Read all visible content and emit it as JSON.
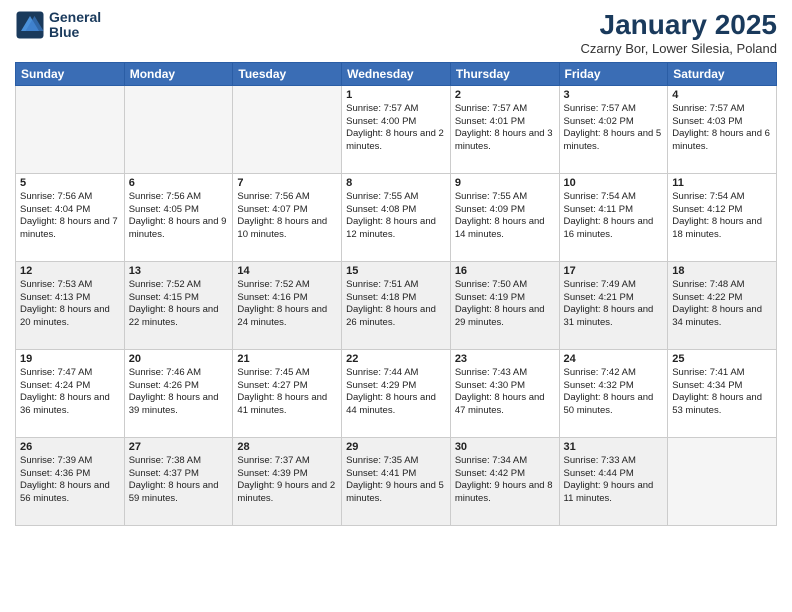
{
  "logo": {
    "line1": "General",
    "line2": "Blue"
  },
  "title": "January 2025",
  "subtitle": "Czarny Bor, Lower Silesia, Poland",
  "headers": [
    "Sunday",
    "Monday",
    "Tuesday",
    "Wednesday",
    "Thursday",
    "Friday",
    "Saturday"
  ],
  "weeks": [
    [
      {
        "day": "",
        "text": "",
        "empty": true
      },
      {
        "day": "",
        "text": "",
        "empty": true
      },
      {
        "day": "",
        "text": "",
        "empty": true
      },
      {
        "day": "1",
        "text": "Sunrise: 7:57 AM\nSunset: 4:00 PM\nDaylight: 8 hours and 2 minutes."
      },
      {
        "day": "2",
        "text": "Sunrise: 7:57 AM\nSunset: 4:01 PM\nDaylight: 8 hours and 3 minutes."
      },
      {
        "day": "3",
        "text": "Sunrise: 7:57 AM\nSunset: 4:02 PM\nDaylight: 8 hours and 5 minutes."
      },
      {
        "day": "4",
        "text": "Sunrise: 7:57 AM\nSunset: 4:03 PM\nDaylight: 8 hours and 6 minutes."
      }
    ],
    [
      {
        "day": "5",
        "text": "Sunrise: 7:56 AM\nSunset: 4:04 PM\nDaylight: 8 hours and 7 minutes."
      },
      {
        "day": "6",
        "text": "Sunrise: 7:56 AM\nSunset: 4:05 PM\nDaylight: 8 hours and 9 minutes."
      },
      {
        "day": "7",
        "text": "Sunrise: 7:56 AM\nSunset: 4:07 PM\nDaylight: 8 hours and 10 minutes."
      },
      {
        "day": "8",
        "text": "Sunrise: 7:55 AM\nSunset: 4:08 PM\nDaylight: 8 hours and 12 minutes."
      },
      {
        "day": "9",
        "text": "Sunrise: 7:55 AM\nSunset: 4:09 PM\nDaylight: 8 hours and 14 minutes."
      },
      {
        "day": "10",
        "text": "Sunrise: 7:54 AM\nSunset: 4:11 PM\nDaylight: 8 hours and 16 minutes."
      },
      {
        "day": "11",
        "text": "Sunrise: 7:54 AM\nSunset: 4:12 PM\nDaylight: 8 hours and 18 minutes."
      }
    ],
    [
      {
        "day": "12",
        "text": "Sunrise: 7:53 AM\nSunset: 4:13 PM\nDaylight: 8 hours and 20 minutes.",
        "shaded": true
      },
      {
        "day": "13",
        "text": "Sunrise: 7:52 AM\nSunset: 4:15 PM\nDaylight: 8 hours and 22 minutes.",
        "shaded": true
      },
      {
        "day": "14",
        "text": "Sunrise: 7:52 AM\nSunset: 4:16 PM\nDaylight: 8 hours and 24 minutes.",
        "shaded": true
      },
      {
        "day": "15",
        "text": "Sunrise: 7:51 AM\nSunset: 4:18 PM\nDaylight: 8 hours and 26 minutes.",
        "shaded": true
      },
      {
        "day": "16",
        "text": "Sunrise: 7:50 AM\nSunset: 4:19 PM\nDaylight: 8 hours and 29 minutes.",
        "shaded": true
      },
      {
        "day": "17",
        "text": "Sunrise: 7:49 AM\nSunset: 4:21 PM\nDaylight: 8 hours and 31 minutes.",
        "shaded": true
      },
      {
        "day": "18",
        "text": "Sunrise: 7:48 AM\nSunset: 4:22 PM\nDaylight: 8 hours and 34 minutes.",
        "shaded": true
      }
    ],
    [
      {
        "day": "19",
        "text": "Sunrise: 7:47 AM\nSunset: 4:24 PM\nDaylight: 8 hours and 36 minutes."
      },
      {
        "day": "20",
        "text": "Sunrise: 7:46 AM\nSunset: 4:26 PM\nDaylight: 8 hours and 39 minutes."
      },
      {
        "day": "21",
        "text": "Sunrise: 7:45 AM\nSunset: 4:27 PM\nDaylight: 8 hours and 41 minutes."
      },
      {
        "day": "22",
        "text": "Sunrise: 7:44 AM\nSunset: 4:29 PM\nDaylight: 8 hours and 44 minutes."
      },
      {
        "day": "23",
        "text": "Sunrise: 7:43 AM\nSunset: 4:30 PM\nDaylight: 8 hours and 47 minutes."
      },
      {
        "day": "24",
        "text": "Sunrise: 7:42 AM\nSunset: 4:32 PM\nDaylight: 8 hours and 50 minutes."
      },
      {
        "day": "25",
        "text": "Sunrise: 7:41 AM\nSunset: 4:34 PM\nDaylight: 8 hours and 53 minutes."
      }
    ],
    [
      {
        "day": "26",
        "text": "Sunrise: 7:39 AM\nSunset: 4:36 PM\nDaylight: 8 hours and 56 minutes.",
        "shaded": true
      },
      {
        "day": "27",
        "text": "Sunrise: 7:38 AM\nSunset: 4:37 PM\nDaylight: 8 hours and 59 minutes.",
        "shaded": true
      },
      {
        "day": "28",
        "text": "Sunrise: 7:37 AM\nSunset: 4:39 PM\nDaylight: 9 hours and 2 minutes.",
        "shaded": true
      },
      {
        "day": "29",
        "text": "Sunrise: 7:35 AM\nSunset: 4:41 PM\nDaylight: 9 hours and 5 minutes.",
        "shaded": true
      },
      {
        "day": "30",
        "text": "Sunrise: 7:34 AM\nSunset: 4:42 PM\nDaylight: 9 hours and 8 minutes.",
        "shaded": true
      },
      {
        "day": "31",
        "text": "Sunrise: 7:33 AM\nSunset: 4:44 PM\nDaylight: 9 hours and 11 minutes.",
        "shaded": true
      },
      {
        "day": "",
        "text": "",
        "empty": true,
        "shaded": false
      }
    ]
  ]
}
